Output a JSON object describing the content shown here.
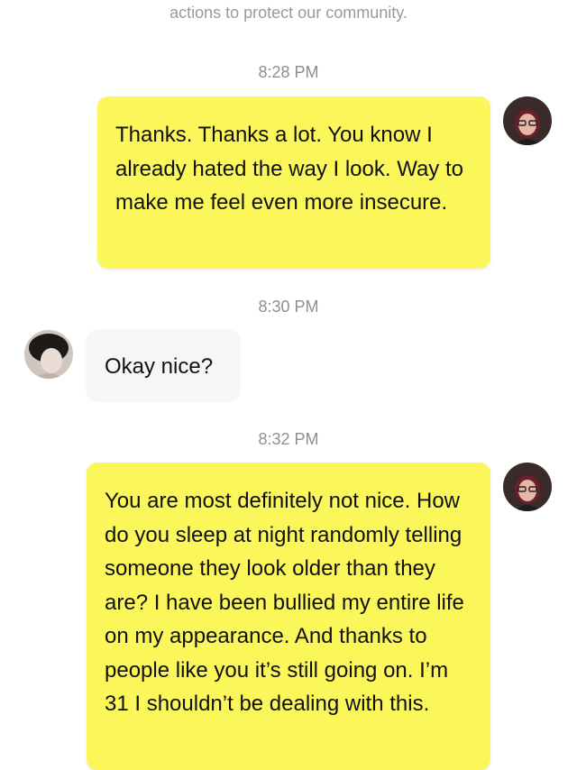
{
  "notice": "actions to protect our community.",
  "messages": [
    {
      "timestamp": "8:28 PM",
      "sender": "self",
      "text": "Thanks. Thanks a lot. You know I already hated the way I look. Way to make me feel even more insecure."
    },
    {
      "timestamp": "8:30 PM",
      "sender": "other",
      "text": "Okay nice?"
    },
    {
      "timestamp": "8:32 PM",
      "sender": "self",
      "text": "You are most definitely not nice. How do you sleep at night randomly telling someone they look older than they are? I have been bullied my entire life on my appearance. And thanks to people like you it’s still going on. I’m 31 I shouldn’t be dealing with this."
    }
  ],
  "colors": {
    "outgoing_bubble": "#fbf75a",
    "incoming_bubble": "#f6f6f6",
    "timestamp_text": "#8e8e8e"
  }
}
